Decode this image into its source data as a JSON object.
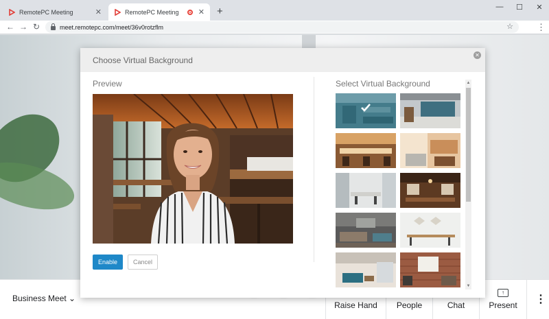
{
  "browser": {
    "tabs": [
      {
        "title": "RemotePC Meeting",
        "active": false
      },
      {
        "title": "RemotePC Meeting",
        "active": true
      }
    ],
    "new_tab": "+",
    "address": "meet.remotepc.com/meet/36v0rotzflm",
    "icons": {
      "back": "back-arrow-icon",
      "forward": "forward-arrow-icon",
      "reload": "reload-icon",
      "bookmark": "star-icon",
      "menu": "more-vert-icon"
    }
  },
  "dialog": {
    "title": "Choose Virtual Background",
    "preview_label": "Preview",
    "select_label": "Select Virtual Background",
    "enable_label": "Enable",
    "cancel_label": "Cancel",
    "selected_index": 0
  },
  "toolbar": {
    "meeting_name": "Business Meet",
    "raise_hand": "Raise Hand",
    "people": "People",
    "chat": "Chat",
    "present": "Present"
  },
  "colors": {
    "accent": "#1e88c8",
    "recording": "#e8453c",
    "brand_red": "#e2403a"
  }
}
